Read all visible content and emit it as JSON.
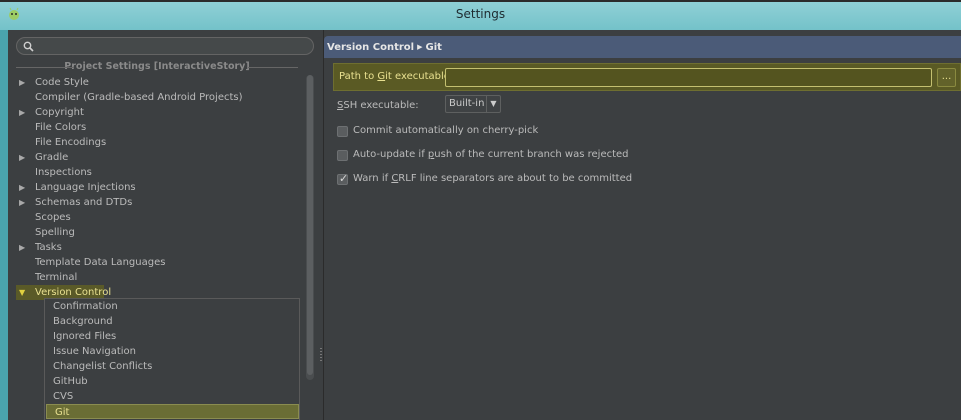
{
  "window": {
    "title": "Settings"
  },
  "left_panel": {
    "search": {
      "value": "",
      "placeholder": ""
    },
    "section_header": "Project Settings [InteractiveStory]",
    "tree": [
      {
        "label": "Code Style",
        "expandable": true
      },
      {
        "label": "Compiler (Gradle-based Android Projects)",
        "expandable": false
      },
      {
        "label": "Copyright",
        "expandable": true
      },
      {
        "label": "File Colors",
        "expandable": false
      },
      {
        "label": "File Encodings",
        "expandable": false
      },
      {
        "label": "Gradle",
        "expandable": true
      },
      {
        "label": "Inspections",
        "expandable": false
      },
      {
        "label": "Language Injections",
        "expandable": true
      },
      {
        "label": "Schemas and DTDs",
        "expandable": true
      },
      {
        "label": "Scopes",
        "expandable": false
      },
      {
        "label": "Spelling",
        "expandable": false
      },
      {
        "label": "Tasks",
        "expandable": true
      },
      {
        "label": "Template Data Languages",
        "expandable": false
      },
      {
        "label": "Terminal",
        "expandable": false
      },
      {
        "label": "Version Control",
        "expandable": true,
        "expanded": true
      }
    ],
    "version_control_children": [
      "Confirmation",
      "Background",
      "Ignored Files",
      "Issue Navigation",
      "Changelist Conflicts",
      "GitHub",
      "CVS",
      "Git"
    ],
    "selected": "Git"
  },
  "right_panel": {
    "breadcrumb": {
      "parent": "Version Control",
      "current": "Git"
    },
    "path_to_git": {
      "label_pre": "Path to ",
      "label_mnemonic": "G",
      "label_post": "it executable:",
      "value": "",
      "browse_label": "..."
    },
    "ssh": {
      "label_mnemonic": "S",
      "label_post": "SH executable:",
      "selected": "Built-in"
    },
    "checkboxes": [
      {
        "pre": "Commit automatically on cherry-pick",
        "mnemonic": "",
        "post": "",
        "checked": false
      },
      {
        "pre": "Auto-update if ",
        "mnemonic": "p",
        "post": "ush of the current branch was rejected",
        "checked": false
      },
      {
        "pre": "Warn if ",
        "mnemonic": "C",
        "post": "RLF line separators are about to be committed",
        "checked": true
      }
    ]
  },
  "colors": {
    "dialog_bg": "#3c3f41",
    "breadcrumb_bg": "#4b5b78",
    "highlight": "#5a5a24",
    "titlebar": "#74c2c9"
  }
}
